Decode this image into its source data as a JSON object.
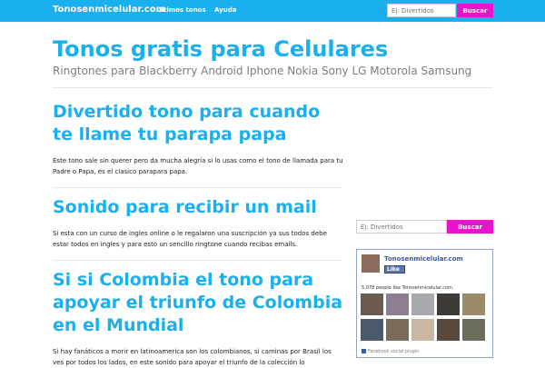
{
  "topbar": {
    "brand": "Tonosenmicelular.com",
    "nav": [
      "Ultimos tonos",
      "Ayuda"
    ],
    "search_placeholder": "Ej: Divertidos",
    "search_button": "Buscar"
  },
  "header": {
    "title": "Tonos gratis para Celulares",
    "subtitle": "Ringtones para Blackberry Android Iphone Nokia Sony LG Motorola Samsung"
  },
  "posts": [
    {
      "title": "Divertido tono para cuando te llame tu parapa papa",
      "body": "Este tono sale sin querer pero da mucha alegría si lo usas como el tono de llamada para tu Padre o Papa, es el clasico parapara papa."
    },
    {
      "title": "Sonido para recibir un mail",
      "body": "Si esta con un curso de ingles online o le regalaron una suscripción ya sus todos debe estar todos en ingles y para esto un sencillo ringtone cuando recibas emails."
    },
    {
      "title": "Si si Colombia el tono para apoyar el triunfo de Colombia en el Mundial",
      "body": "Si hay fanáticos a morir en latinoamerica son los colombianos, si caminas por Brasil los ves por todos los lados, en este sonido para apoyar el triunfo de la colección lo"
    }
  ],
  "sidebar": {
    "search_placeholder": "Ej: Divertidos",
    "search_button": "Buscar",
    "facebook": {
      "page_name": "Tonosenmicelular.com",
      "like_label": "Like",
      "count_text": "5,078 people like Tonosenmicelular.com.",
      "plugin_text": "Facebook social plugin",
      "face_colors": [
        "#6b5a4e",
        "#8c7d8f",
        "#a8a9ad",
        "#3d3a38",
        "#9c8a6a",
        "#4a5a6b",
        "#7a6a5a",
        "#c9b7a3",
        "#5a4a3e",
        "#6a6e5a"
      ]
    }
  }
}
